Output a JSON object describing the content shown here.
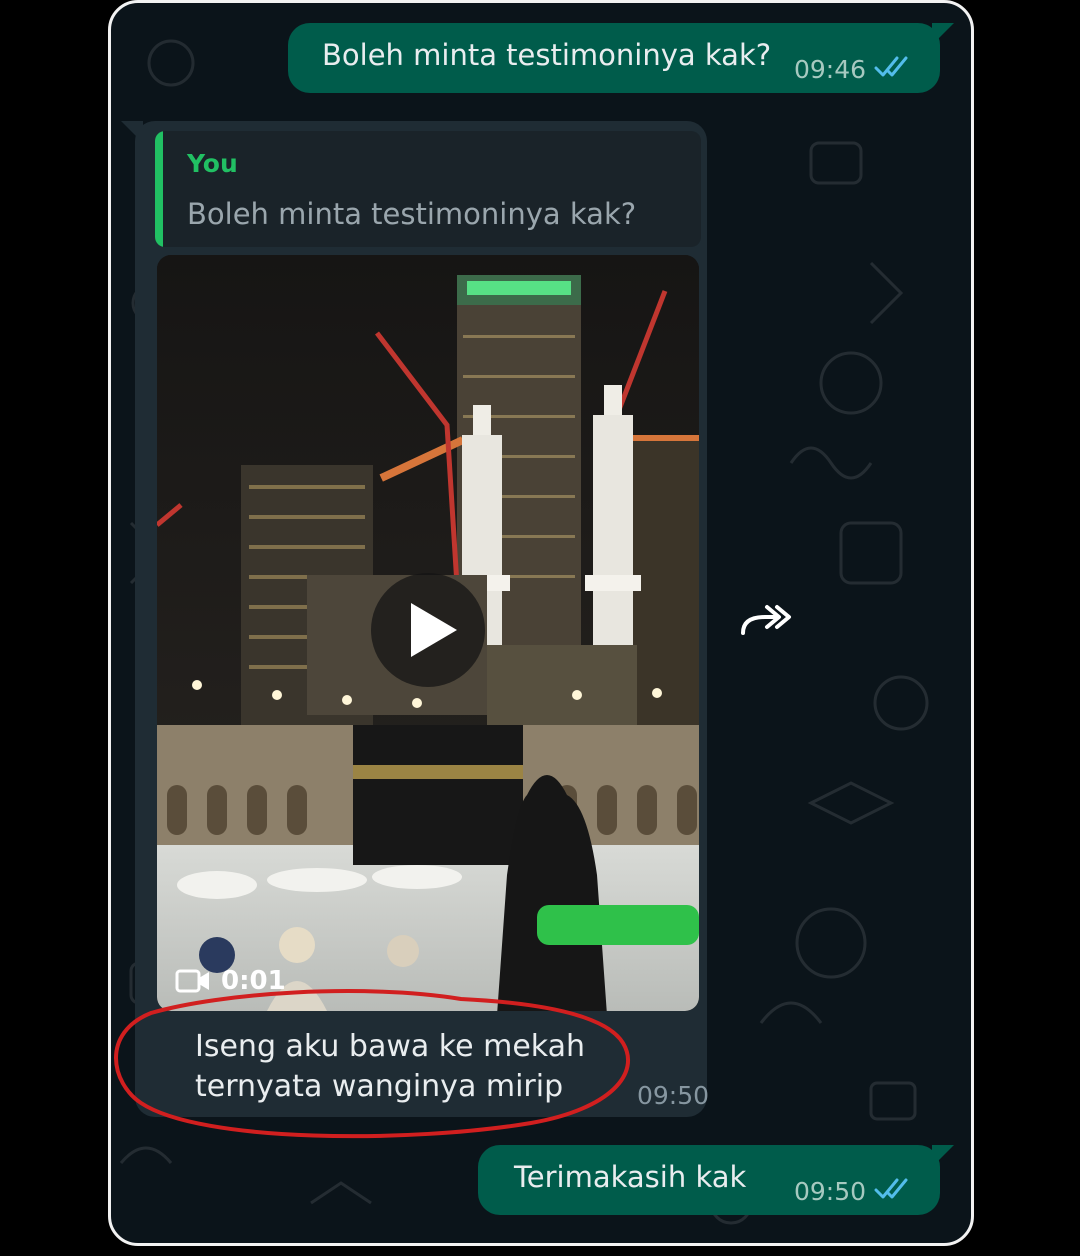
{
  "chat": {
    "messages": [
      {
        "type": "outgoing",
        "text": "Boleh minta testimoninya kak?",
        "time": "09:46",
        "status": "read"
      },
      {
        "type": "incoming",
        "reply_to": {
          "author": "You",
          "text": "Boleh minta testimoninya kak?"
        },
        "media": {
          "kind": "video",
          "duration": "0:01"
        },
        "caption_lines": [
          "Iseng aku bawa ke mekah",
          "ternyata wanginya mirip"
        ],
        "time": "09:50"
      },
      {
        "type": "outgoing",
        "text": "Terimakasih kak",
        "time": "09:50",
        "status": "read"
      }
    ]
  },
  "colors": {
    "outgoing_bubble": "#005c4b",
    "incoming_bubble": "#1f2c34",
    "chat_background": "#0b141a",
    "quote_accent": "#21c063",
    "read_ticks": "#53bdeb",
    "annotation_circle": "#d11f1f"
  },
  "icons": {
    "play": "play-icon",
    "video_camera": "video-camera-icon",
    "forward": "forward-icon",
    "read_receipt": "double-check-icon"
  }
}
